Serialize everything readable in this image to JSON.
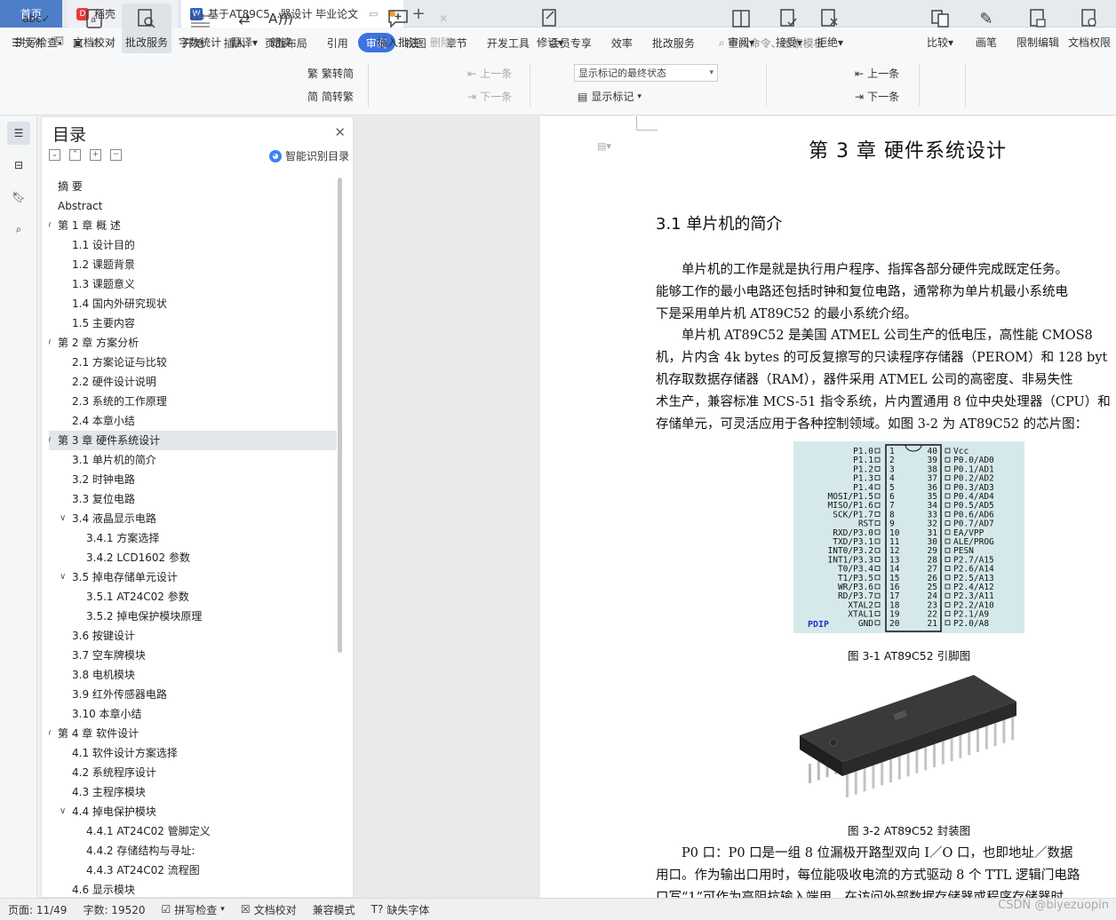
{
  "tabs": {
    "home": "首页",
    "docer": "稻壳",
    "active": "基于AT89C5...器设计 毕业论文"
  },
  "menu": {
    "file": "文件",
    "items": [
      "开始",
      "插入",
      "页面布局",
      "引用",
      "审阅",
      "视图",
      "章节",
      "开发工具",
      "会员专享",
      "效率",
      "批改服务"
    ],
    "active_item": "审阅",
    "search": "查找命令、搜索模板"
  },
  "ribbon": {
    "spell": "拼写检查",
    "proofread": "文档校对",
    "grading": "批改服务",
    "wordcount": "字数统计",
    "translate": "翻译",
    "readaloud": "朗读",
    "trad": "繁转简",
    "simp": "简转繁",
    "insert_comment": "插入批注",
    "delete": "删除",
    "prev": "上一条",
    "next": "下一条",
    "revise": "修订",
    "markup_state": "显示标记的最终状态",
    "show_markup": "显示标记",
    "review": "审阅",
    "accept": "接受",
    "reject": "拒绝",
    "prev2": "上一条",
    "next2": "下一条",
    "compare": "比较",
    "pen": "画笔",
    "restrict": "限制编辑",
    "perm": "文档权限"
  },
  "toc": {
    "title": "目录",
    "smart": "智能识别目录",
    "items": [
      {
        "text": "摘  要",
        "level": 1,
        "caret": ""
      },
      {
        "text": "Abstract",
        "level": 1,
        "caret": ""
      },
      {
        "text": "第 1 章  概  述",
        "level": 1,
        "caret": "v"
      },
      {
        "text": "1.1  设计目的",
        "level": 2,
        "caret": ""
      },
      {
        "text": "1.2  课题背景",
        "level": 2,
        "caret": ""
      },
      {
        "text": "1.3  课题意义",
        "level": 2,
        "caret": ""
      },
      {
        "text": "1.4  国内外研究现状",
        "level": 2,
        "caret": ""
      },
      {
        "text": "1.5  主要内容",
        "level": 2,
        "caret": ""
      },
      {
        "text": "第 2 章  方案分析",
        "level": 1,
        "caret": "v"
      },
      {
        "text": "2.1  方案论证与比较",
        "level": 2,
        "caret": ""
      },
      {
        "text": "2.2  硬件设计说明",
        "level": 2,
        "caret": ""
      },
      {
        "text": "2.3  系统的工作原理",
        "level": 2,
        "caret": ""
      },
      {
        "text": "2.4  本章小结",
        "level": 2,
        "caret": ""
      },
      {
        "text": "第 3 章  硬件系统设计",
        "level": 1,
        "caret": "v",
        "selected": true
      },
      {
        "text": "3.1  单片机的简介",
        "level": 2,
        "caret": ""
      },
      {
        "text": "3.2  时钟电路",
        "level": 2,
        "caret": ""
      },
      {
        "text": "3.3  复位电路",
        "level": 2,
        "caret": ""
      },
      {
        "text": "3.4  液晶显示电路",
        "level": 2,
        "caret": "v"
      },
      {
        "text": "3.4.1  方案选择",
        "level": 3,
        "caret": ""
      },
      {
        "text": "3.4.2 LCD1602 参数",
        "level": 3,
        "caret": ""
      },
      {
        "text": "3.5  掉电存储单元设计",
        "level": 2,
        "caret": "v"
      },
      {
        "text": "3.5.1 AT24C02 参数",
        "level": 3,
        "caret": ""
      },
      {
        "text": "3.5.2  掉电保护模块原理",
        "level": 3,
        "caret": ""
      },
      {
        "text": "3.6  按键设计",
        "level": 2,
        "caret": ""
      },
      {
        "text": "3.7  空车牌模块",
        "level": 2,
        "caret": ""
      },
      {
        "text": "3.8  电机模块",
        "level": 2,
        "caret": ""
      },
      {
        "text": "3.9  红外传感器电路",
        "level": 2,
        "caret": ""
      },
      {
        "text": "3.10  本章小结",
        "level": 2,
        "caret": ""
      },
      {
        "text": "第 4 章  软件设计",
        "level": 1,
        "caret": "v"
      },
      {
        "text": "4.1  软件设计方案选择",
        "level": 2,
        "caret": ""
      },
      {
        "text": "4.2  系统程序设计",
        "level": 2,
        "caret": ""
      },
      {
        "text": "4.3  主程序模块",
        "level": 2,
        "caret": ""
      },
      {
        "text": "4.4  掉电保护模块",
        "level": 2,
        "caret": "v"
      },
      {
        "text": "4.4.1 AT24C02 管脚定义",
        "level": 3,
        "caret": ""
      },
      {
        "text": "4.4.2  存储结构与寻址:",
        "level": 3,
        "caret": ""
      },
      {
        "text": "4.4.3 AT24C02 流程图",
        "level": 3,
        "caret": ""
      },
      {
        "text": "4.6  显示模块",
        "level": 2,
        "caret": ""
      }
    ]
  },
  "document": {
    "chapter_title": "第 3 章  硬件系统设计",
    "section_title": "3.1  单片机的简介",
    "lines": [
      "　　单片机的工作是就是执行用户程序、指挥各部分硬件完成既定任务。",
      "能够工作的最小电路还包括时钟和复位电路，通常称为单片机最小系统电",
      "下是采用单片机 AT89C52 的最小系统介绍。",
      "　　单片机 AT89C52 是美国 ATMEL 公司生产的低电压，高性能 CMOS8",
      "机，片内含 4k bytes 的可反复擦写的只读程序存储器（PEROM）和 128 byt",
      "机存取数据存储器（RAM），器件采用 ATMEL 公司的高密度、非易失性",
      "术生产，兼容标准 MCS-51 指令系统，片内置通用 8 位中央处理器（CPU）和",
      "存储单元，可灵活应用于各种控制领域。如图 3-2 为 AT89C52 的芯片图："
    ],
    "fig1_caption": "图 3-1  AT89C52 引脚图",
    "fig2_caption": "图 3-2  AT89C52 封装图",
    "lines2": [
      "　　P0 口：P0 口是一组 8 位漏极开路型双向 I／O 口，也即地址／数据",
      "用口。作为输出口用时，每位能吸收电流的方式驱动 8 个 TTL 逻辑门电路",
      "口写“1”可作为高阻抗输入端用，在访问外部数据存储器或程序存储器时"
    ],
    "pins_left": [
      "P1.0",
      "P1.1",
      "P1.2",
      "P1.3",
      "P1.4",
      "MOSI/P1.5",
      "MISO/P1.6",
      "SCK/P1.7",
      "RST",
      "RXD/P3.0",
      "TXD/P3.1",
      "INT0/P3.2",
      "INT1/P3.3",
      "T0/P3.4",
      "T1/P3.5",
      "WR/P3.6",
      "RD/P3.7",
      "XTAL2",
      "XTAL1",
      "GND"
    ],
    "pins_right": [
      "Vcc",
      "P0.0/AD0",
      "P0.1/AD1",
      "P0.2/AD2",
      "P0.3/AD3",
      "P0.4/AD4",
      "P0.5/AD5",
      "P0.6/AD6",
      "P0.7/AD7",
      "EA/VPP",
      "ALE/PROG",
      "PESN",
      "P2.7/A15",
      "P2.6/A14",
      "P2.5/A13",
      "P2.4/A12",
      "P2.3/A11",
      "P2.2/A10",
      "P2.1/A9",
      "P2.0/A8"
    ],
    "package_label": "PDIP"
  },
  "status": {
    "page": "页面: 11/49",
    "words": "字数: 19520",
    "spell": "拼写检查",
    "proof": "文档校对",
    "compat": "兼容模式",
    "missing_font": "缺失字体"
  },
  "watermark": "CSDN @biyezuopin"
}
